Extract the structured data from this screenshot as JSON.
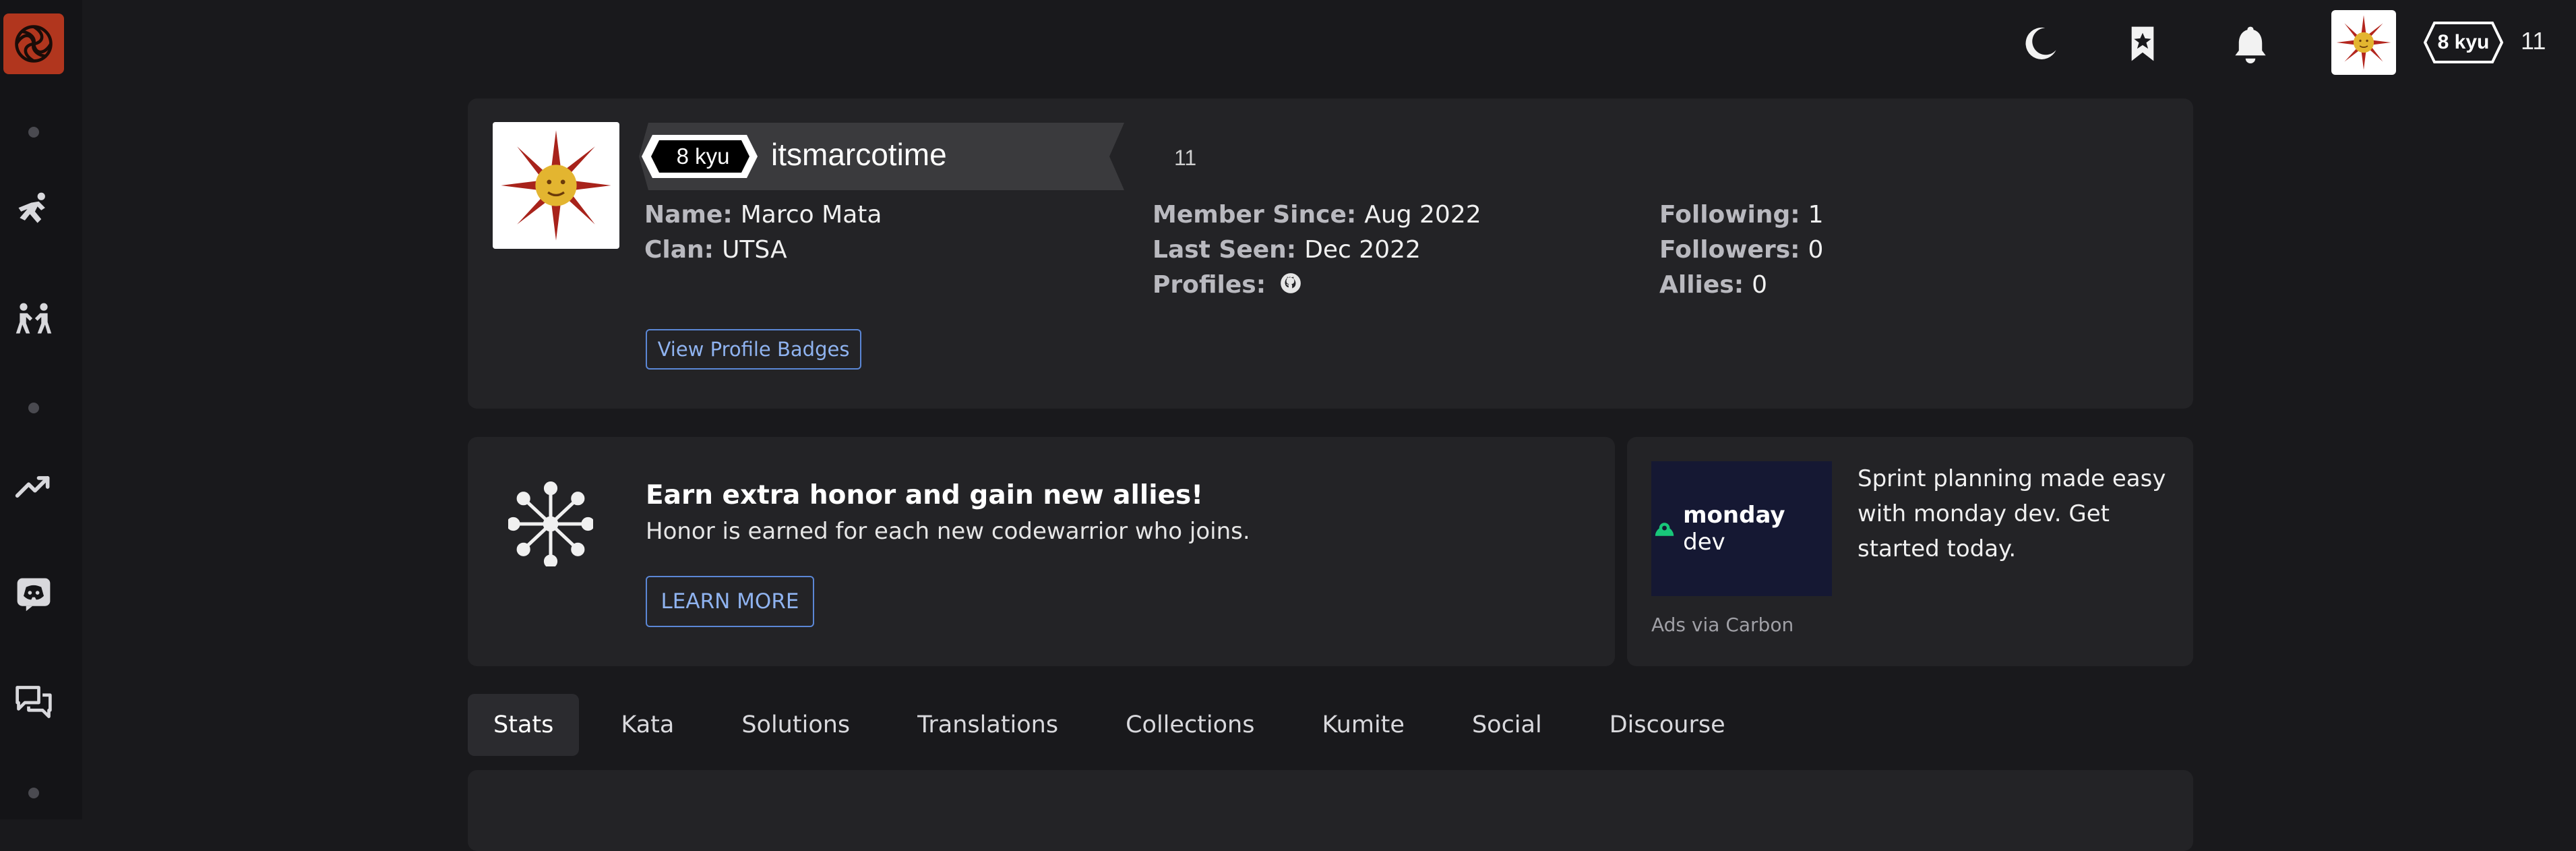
{
  "header": {
    "rank": "8 kyu",
    "honor": "11",
    "icons": [
      "moon-icon",
      "bookmark-star-icon",
      "bell-icon"
    ]
  },
  "sidebar": {
    "logo": "codewars-logo",
    "icons": [
      "kata-practice-icon",
      "kumite-icon",
      "leaderboard-trend-icon",
      "discord-icon",
      "discourse-chat-icon"
    ]
  },
  "profile": {
    "rank": "8 kyu",
    "username": "itsmarcotime",
    "honor": "11",
    "name_label": "Name:",
    "name": "Marco Mata",
    "clan_label": "Clan:",
    "clan": "UTSA",
    "member_since_label": "Member Since:",
    "member_since": "Aug 2022",
    "last_seen_label": "Last Seen:",
    "last_seen": "Dec 2022",
    "profiles_label": "Profiles:",
    "following_label": "Following:",
    "following": "1",
    "followers_label": "Followers:",
    "followers": "0",
    "allies_label": "Allies:",
    "allies": "0",
    "badges_button": "View Profile Badges"
  },
  "promo": {
    "title": "Earn extra honor and gain new allies!",
    "text": "Honor is earned for each new codewarrior who joins.",
    "button": "LEARN MORE"
  },
  "ad": {
    "brand": "monday",
    "brand_suffix": "dev",
    "text": "Sprint planning made easy with monday dev. Get started today.",
    "via": "Ads via Carbon"
  },
  "tabs": [
    {
      "label": "Stats",
      "active": true
    },
    {
      "label": "Kata"
    },
    {
      "label": "Solutions"
    },
    {
      "label": "Translations"
    },
    {
      "label": "Collections"
    },
    {
      "label": "Kumite"
    },
    {
      "label": "Social"
    },
    {
      "label": "Discourse"
    }
  ],
  "colors": {
    "background": "#19191c",
    "card": "#232326",
    "accent_blue": "#5b87d6",
    "logo_red": "#b1361e"
  }
}
